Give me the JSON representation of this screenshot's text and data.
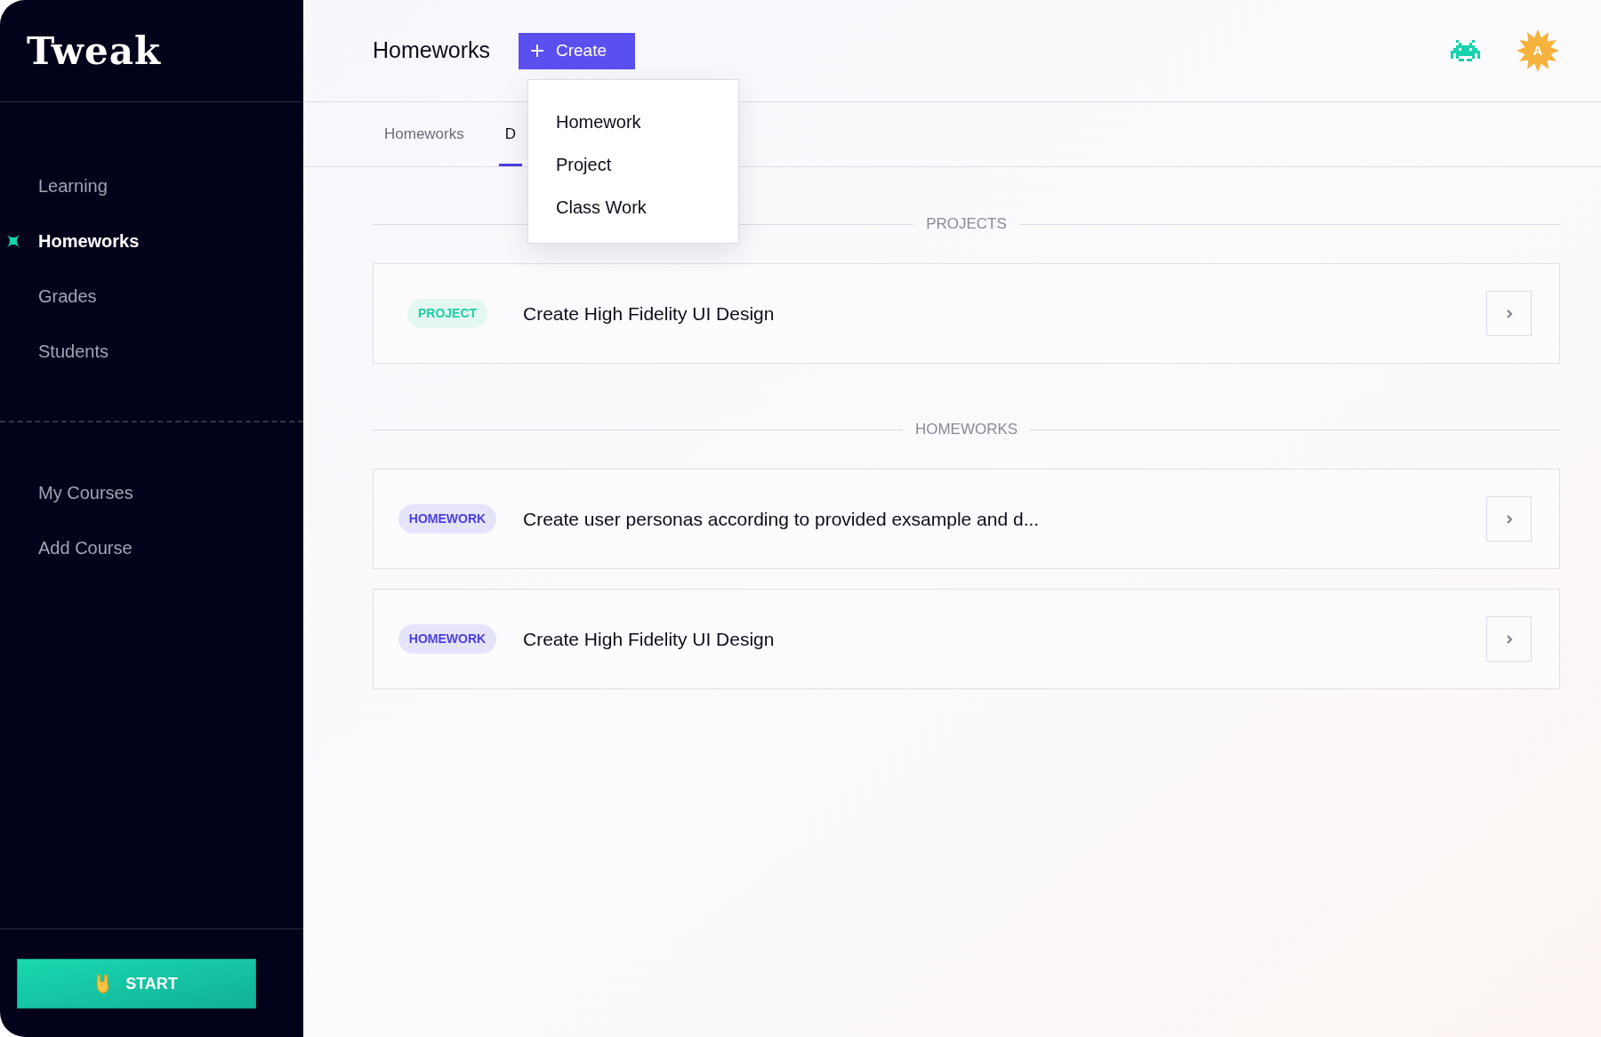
{
  "logo": "Tweak",
  "nav": [
    {
      "label": "Learning",
      "selected": false
    },
    {
      "label": "Homeworks",
      "selected": true
    },
    {
      "label": "Grades",
      "selected": false
    },
    {
      "label": "Students",
      "selected": false
    }
  ],
  "courses": [
    {
      "label": "My Courses",
      "selected": false
    },
    {
      "label": "Add Course",
      "selected": false
    }
  ],
  "start_button": {
    "label": "START"
  },
  "header": {
    "title": "Homeworks",
    "create_button": "Create",
    "avatar_initial": "A"
  },
  "create_menu": {
    "items": [
      "Homework",
      "Project",
      "Class Work"
    ]
  },
  "tabs": [
    {
      "label": "Homeworks",
      "selected": false
    },
    {
      "label": "D",
      "selected": true
    }
  ],
  "sections": [
    {
      "title": "PROJECTS",
      "items": [
        {
          "kind": "project",
          "tag": "PROJECT",
          "title": "Create High Fidelity UI Design"
        }
      ]
    },
    {
      "title": "HOMEWORKS",
      "items": [
        {
          "kind": "homework",
          "tag": "HOMEWORK",
          "title": "Create user personas according to provided exsample and d..."
        },
        {
          "kind": "homework",
          "tag": "HOMEWORK",
          "title": "Create High Fidelity UI Design"
        }
      ]
    }
  ]
}
